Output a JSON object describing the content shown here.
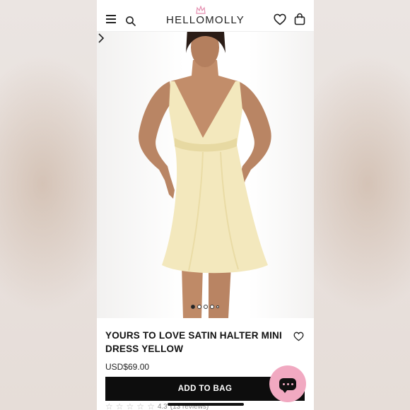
{
  "header": {
    "logo_text": "HELLOMOLLY",
    "menu_icon": "hamburger-icon",
    "search_icon": "search-icon",
    "wishlist_icon": "heart-icon",
    "bag_icon": "shopping-bag-icon"
  },
  "gallery": {
    "slide_count": 5,
    "active_index": 0,
    "next_icon": "chevron-right-icon"
  },
  "product": {
    "title_line1": "YOURS TO LOVE SATIN HALTER MINI",
    "title_line2": "DRESS YELLOW",
    "price": "USD$69.00",
    "add_to_bag_label": "ADD TO BAG",
    "rating": "4.3",
    "reviews": "(13 reviews)",
    "favorite_icon": "heart-icon"
  },
  "chat": {
    "icon": "chat-icon",
    "color": "#f1a9c1"
  },
  "colors": {
    "dress": "#f3e8bd",
    "button": "#0d0d0d"
  }
}
